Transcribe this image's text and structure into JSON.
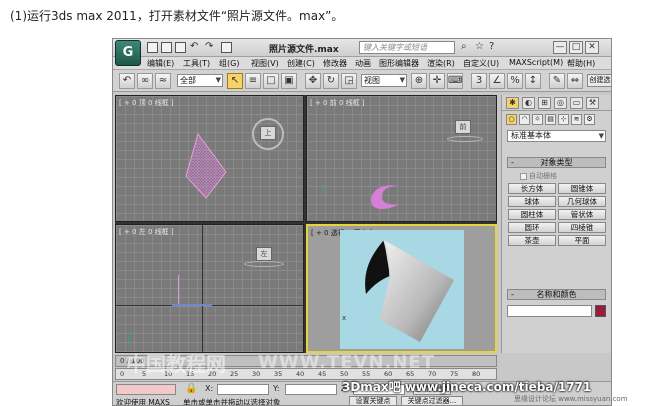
{
  "caption": "(1)运行3ds max 2011，打开素材文件“照片源文件。max”。",
  "app": {
    "logo": "G",
    "doc_title": "照片源文件.max",
    "search_placeholder": "键入关键字或短语",
    "window_buttons": [
      "—",
      "□",
      "✕"
    ]
  },
  "menu": [
    "编辑(E)",
    "工具(T)",
    "组(G)",
    "视图(V)",
    "创建(C)",
    "修改器",
    "动画",
    "图形编辑器",
    "渲染(R)",
    "自定义(U)",
    "MAXScript(M)",
    "帮助(H)"
  ],
  "toolbar": {
    "selection_filter": "全部",
    "ref_coord": "视图",
    "create_selection_label": "创建选"
  },
  "viewports": {
    "top": "[ + 0 顶 0 线框 ]",
    "front": "[ + 0 前 0 线框 ]",
    "left": "[ + 0 左 0 线框 ]",
    "perspective": "[ + 0 透视 0 真实 ]",
    "cube_top": "上",
    "cube_front": "前",
    "cube_left": "左"
  },
  "command_panel": {
    "dropdown": "标准基本体",
    "object_type_title": "对象类型",
    "autogrid": "自动栅格",
    "buttons": [
      "长方体",
      "圆锥体",
      "球体",
      "几何球体",
      "圆柱体",
      "管状体",
      "圆环",
      "四棱锥",
      "茶壶",
      "平面"
    ],
    "name_color_title": "名称和颜色",
    "rollout_sign": "-"
  },
  "timeline": {
    "slider_label": "0 / 100",
    "ticks": [
      "0",
      "5",
      "10",
      "15",
      "20",
      "25",
      "30",
      "35",
      "40",
      "45",
      "50",
      "55",
      "60",
      "65",
      "70",
      "75",
      "80"
    ]
  },
  "status": {
    "welcome": "欢迎使用 MAXS",
    "prompt": "单击或单击并拖动以选择对象",
    "coord_x": "X:",
    "coord_y": "Y:",
    "coord_z": "Z:",
    "set_key": "设置关键点",
    "key_filter": "关键点过滤器...",
    "auto_key": "自动关键点"
  },
  "watermarks": {
    "left": "中国教程网",
    "center": "WWW.TEVN.NET",
    "right": "3Dmax吧 www.jineca.com/tieba/1771",
    "corner": "思缘设计论坛 www.missyuan.com"
  }
}
